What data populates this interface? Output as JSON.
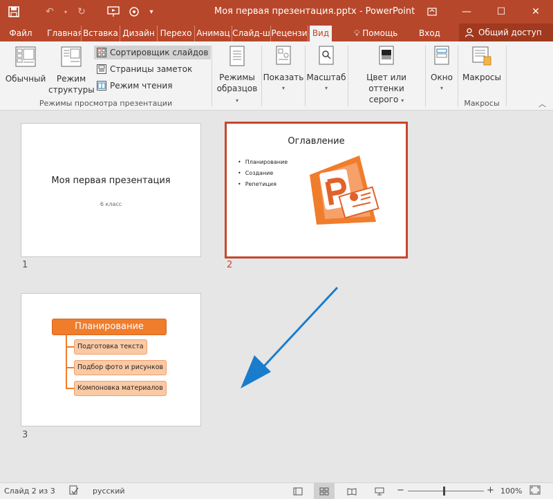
{
  "app": {
    "window_title": "Моя первая презентация.pptx - PowerPoint",
    "brand_color": "#b7472a"
  },
  "quick_access": {
    "save_icon": "save-icon",
    "undo_icon": "undo-icon",
    "redo_icon": "redo-icon",
    "present_icon": "present-from-start-icon",
    "customize_icon": "customize-qat-icon"
  },
  "tabs": [
    {
      "label": "Файл"
    },
    {
      "label": "Главная"
    },
    {
      "label": "Вставка"
    },
    {
      "label": "Дизайн"
    },
    {
      "label": "Перехо"
    },
    {
      "label": "Анимац"
    },
    {
      "label": "Слайд-ш"
    },
    {
      "label": "Рецензи"
    },
    {
      "label": "Вид"
    }
  ],
  "tab_extras": {
    "help": "Помощь",
    "signin": "Вход",
    "share": "Общий доступ"
  },
  "ribbon": {
    "normal": "Обычный",
    "outline_line1": "Режим",
    "outline_line2": "структуры",
    "slide_sorter": "Сортировщик слайдов",
    "notes_page": "Страницы заметок",
    "reading_view": "Режим чтения",
    "group_views": "Режимы просмотра презентации",
    "master_line1": "Режимы",
    "master_line2": "образцов",
    "show": "Показать",
    "zoom": "Масштаб",
    "color_line1": "Цвет или оттенки",
    "color_line2": "серого",
    "window": "Окно",
    "macros": "Макросы",
    "group_macros": "Макросы"
  },
  "slides": [
    {
      "number": "1",
      "title": "Моя первая презентация",
      "subtitle": "6 класс"
    },
    {
      "number": "2",
      "title": "Оглавление",
      "bullets": [
        "Планирование",
        "Создание",
        "Репетиция"
      ]
    },
    {
      "number": "3",
      "header": "Планирование",
      "items": [
        "Подготовка текста",
        "Подбор фото и рисунков",
        "Компоновка материалов"
      ]
    }
  ],
  "status": {
    "slide_info": "Слайд 2 из 3",
    "language": "русский",
    "zoom": "100%",
    "zoom_minus": "−",
    "zoom_plus": "+"
  }
}
